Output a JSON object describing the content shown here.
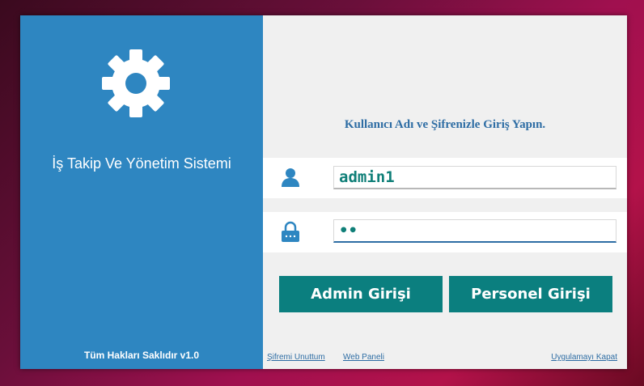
{
  "left_panel": {
    "app_title": "İş Takip Ve Yönetim Sistemi",
    "copyright": "Tüm Hakları Saklıdır v1.0",
    "background": "#2e86c1",
    "icon": "gear-icon"
  },
  "login": {
    "heading": "Kullanıcı Adı ve Şifrenizle Giriş Yapın.",
    "username": {
      "value": "admin1",
      "icon": "user-icon"
    },
    "password": {
      "masked_value": "••",
      "icon": "lock-icon"
    },
    "accent": "#0b7f7f"
  },
  "buttons": {
    "admin_label": "Admin Girişi",
    "personel_label": "Personel Girişi"
  },
  "links": {
    "forgot_password": "Şifremi Unuttum",
    "web_panel": "Web Paneli",
    "close_app": "Uygulamayı Kapat"
  }
}
